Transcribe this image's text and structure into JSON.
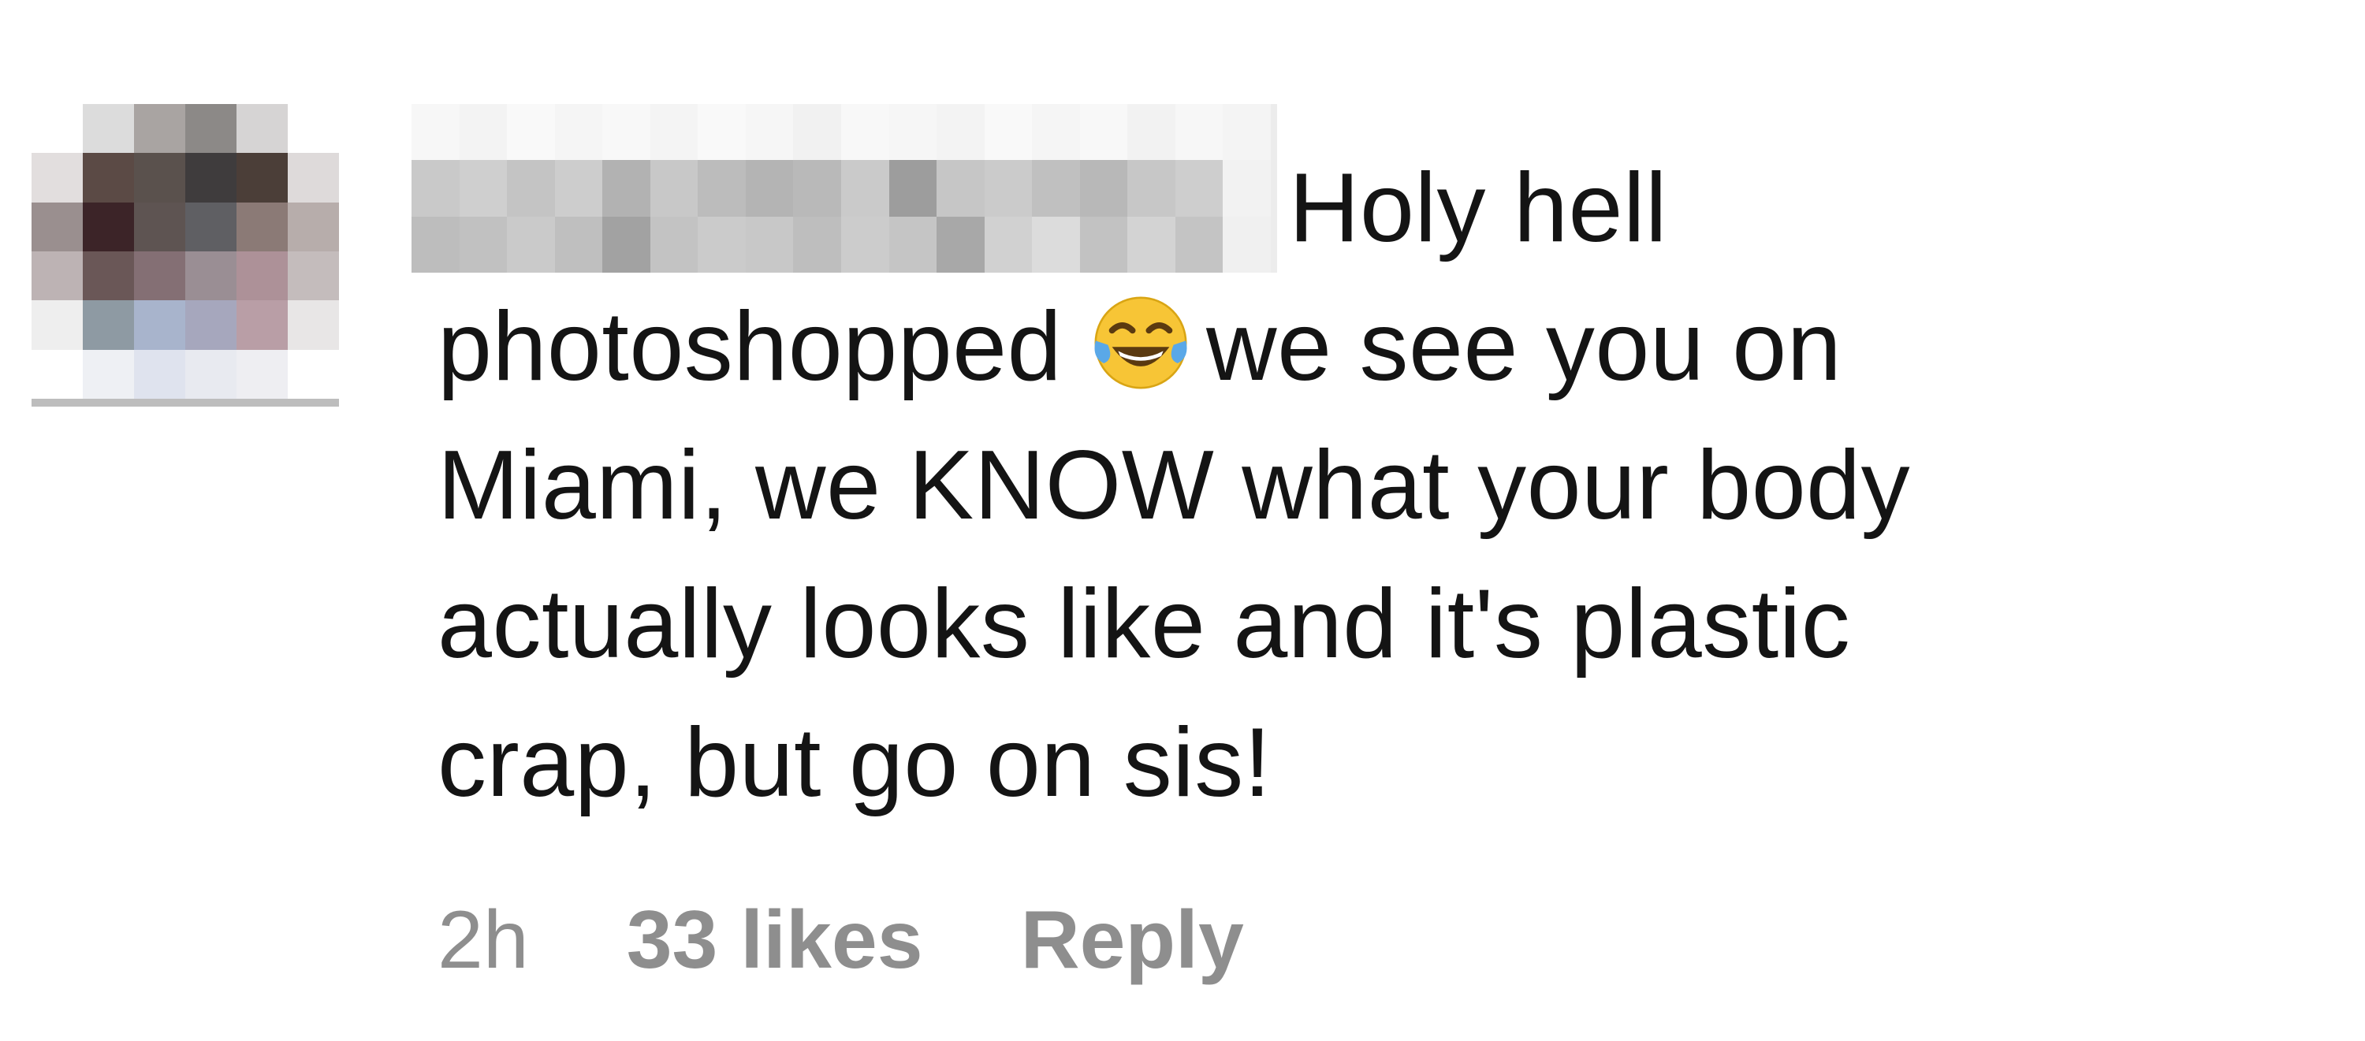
{
  "comment": {
    "text_lines": [
      "Holy hell",
      "photoshopped",
      "we see you on",
      "Miami, we KNOW what your body",
      "actually looks like and it's plastic",
      "crap, but go on sis!"
    ],
    "emoji": "face-with-tears-of-joy-icon",
    "timestamp": "2h",
    "likes": "33 likes",
    "reply_label": "Reply"
  },
  "colors": {
    "text": "#141414",
    "meta": "#8e8e8e",
    "emoji_face": "#f7c536",
    "emoji_tears": "#5aa8e8"
  }
}
